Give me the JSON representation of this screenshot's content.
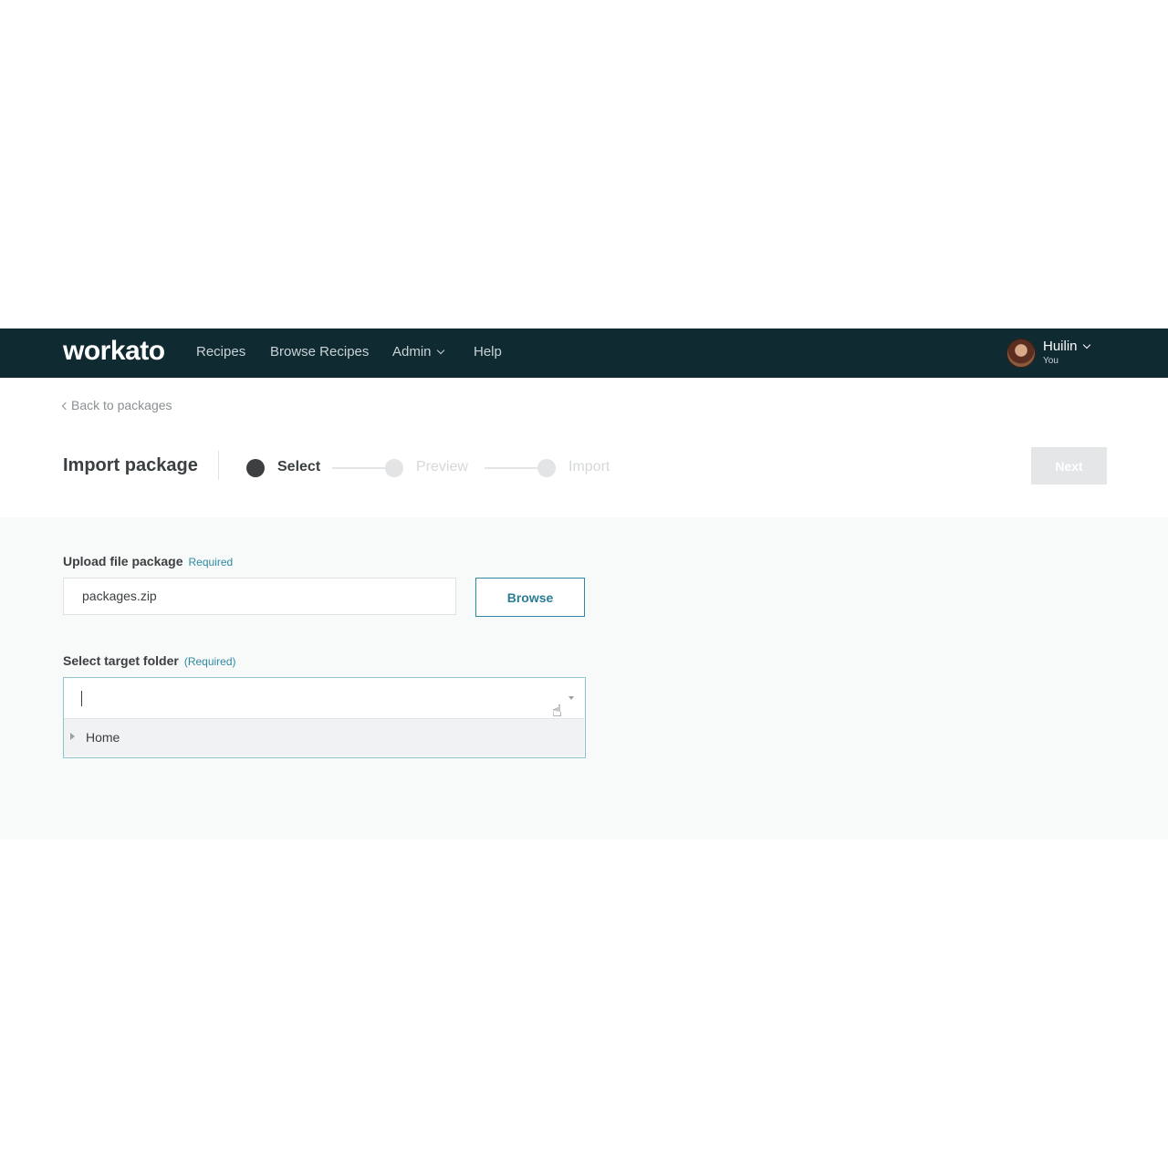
{
  "nav": {
    "logo": "workato",
    "items": [
      "Recipes",
      "Browse Recipes",
      "Admin",
      "Help"
    ],
    "user_name": "Huilin",
    "user_sub": "You"
  },
  "header": {
    "back_link": "Back to packages",
    "title": "Import package",
    "steps": [
      {
        "label": "Select",
        "state": "active"
      },
      {
        "label": "Preview",
        "state": "inactive"
      },
      {
        "label": "Import",
        "state": "inactive"
      }
    ],
    "next_label": "Next"
  },
  "form": {
    "upload_label": "Upload file package",
    "upload_required": "Required",
    "file_value": "packages.zip",
    "browse_label": "Browse",
    "folder_label": "Select target folder",
    "folder_required": "(Required)",
    "folder_value": "",
    "tree": [
      {
        "label": "Home",
        "expanded": false
      }
    ]
  },
  "colors": {
    "navbar": "#0f2a31",
    "accent": "#2e8aa3",
    "panel": "#f8f9f9"
  },
  "icons": {
    "dropdown": "chevron-down-icon",
    "tree_toggle": "caret-right-icon",
    "cursor": "hand-pointer-icon"
  }
}
